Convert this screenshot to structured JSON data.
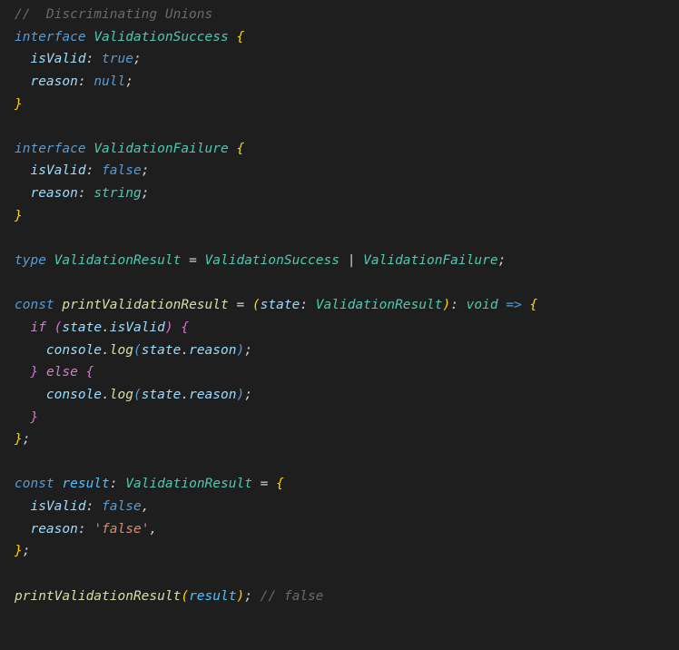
{
  "code": {
    "line1_comment": "//  Discriminating Unions",
    "line2_interface": "interface",
    "line2_name": "ValidationSuccess",
    "line3_prop": "isValid",
    "line3_val": "true",
    "line4_prop": "reason",
    "line4_val": "null",
    "line7_interface": "interface",
    "line7_name": "ValidationFailure",
    "line8_prop": "isValid",
    "line8_val": "false",
    "line9_prop": "reason",
    "line9_val": "string",
    "line12_type": "type",
    "line12_name": "ValidationResult",
    "line12_eq": "=",
    "line12_t1": "ValidationSuccess",
    "line12_pipe": "|",
    "line12_t2": "ValidationFailure",
    "line14_const": "const",
    "line14_name": "printValidationResult",
    "line14_eq": "=",
    "line14_param": "state",
    "line14_ptype": "ValidationResult",
    "line14_ret": "void",
    "line14_arrow": "=>",
    "line15_if": "if",
    "line15_var": "state",
    "line15_prop": "isValid",
    "line16_console": "console",
    "line16_log": "log",
    "line16_var": "state",
    "line16_prop": "reason",
    "line17_else": "else",
    "line18_console": "console",
    "line18_log": "log",
    "line18_var": "state",
    "line18_prop": "reason",
    "line22_const": "const",
    "line22_name": "result",
    "line22_type": "ValidationResult",
    "line23_prop": "isValid",
    "line23_val": "false",
    "line24_prop": "reason",
    "line24_val": "'false'",
    "line27_func": "printValidationResult",
    "line27_arg": "result",
    "line27_comment": "// false"
  }
}
